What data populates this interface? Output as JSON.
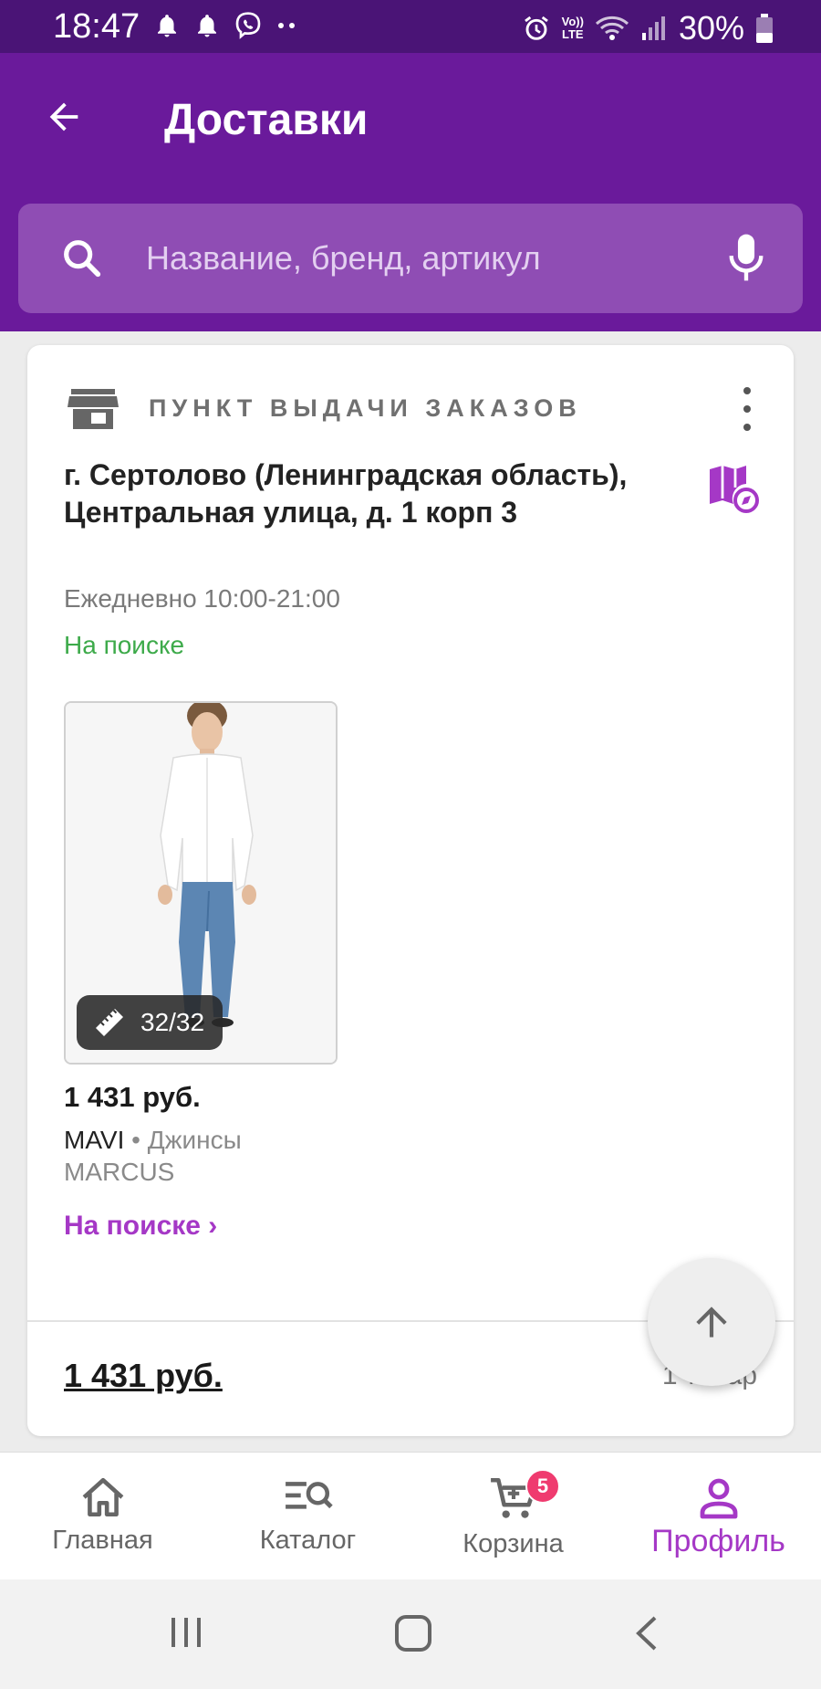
{
  "status_bar": {
    "time": "18:47",
    "network_label": "Vo)) LTE",
    "battery": "30%"
  },
  "header": {
    "title": "Доставки"
  },
  "search": {
    "placeholder": "Название, бренд, артикул"
  },
  "order": {
    "pickup_type": "ПУНКТ ВЫДАЧИ ЗАКАЗОВ",
    "address": "г. Сертолово (Ленинградская область), Центральная улица, д. 1 корп 3",
    "hours": "Ежедневно 10:00-21:00",
    "status": "На поиске",
    "item": {
      "size": "32/32",
      "price": "1 431 руб.",
      "brand": "MAVI",
      "separator": " • ",
      "category": "Джинсы",
      "model": "MARCUS",
      "status_link": "На поиске ›"
    },
    "total": "1 431 руб.",
    "count": "1 товар"
  },
  "bottom_nav": {
    "items": [
      {
        "label": "Главная",
        "icon": "home-icon"
      },
      {
        "label": "Каталог",
        "icon": "catalog-search-icon"
      },
      {
        "label": "Корзина",
        "icon": "cart-icon",
        "badge": "5"
      },
      {
        "label": "Профиль",
        "icon": "profile-icon",
        "active": true
      }
    ]
  },
  "colors": {
    "status_bar": "#4a1476",
    "header": "#6a1a9b",
    "search_bg": "#8f4db4",
    "accent": "#a538c6",
    "status_green": "#3daa4a",
    "badge": "#ef3b6f"
  }
}
